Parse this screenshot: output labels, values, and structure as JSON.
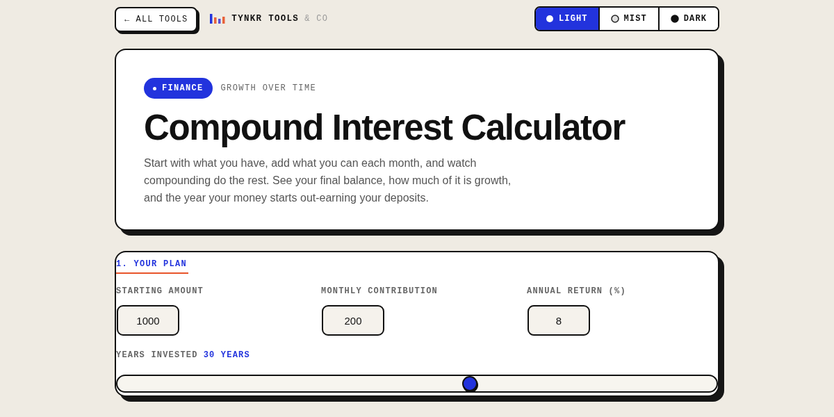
{
  "header": {
    "back_button": "← ALL TOOLS",
    "brand": {
      "name": "TYNKR TOOLS",
      "suffix": "& CO"
    },
    "theme_options": [
      {
        "label": "LIGHT",
        "kind": "light",
        "selected": true
      },
      {
        "label": "MIST",
        "kind": "mist",
        "selected": false
      },
      {
        "label": "DARK",
        "kind": "dark",
        "selected": false
      }
    ]
  },
  "hero": {
    "badge": "FINANCE",
    "eyebrow": "GROWTH OVER TIME",
    "title": "Compound Interest Calculator",
    "description": "Start with what you have, add what you can each month, and watch compounding do the rest. See your final balance, how much of it is growth, and the year your money starts out-earning your deposits."
  },
  "plan": {
    "heading": "1. YOUR PLAN",
    "fields": [
      {
        "label": "STARTING AMOUNT",
        "value": "1000"
      },
      {
        "label": "MONTHLY CONTRIBUTION",
        "value": "200"
      },
      {
        "label": "ANNUAL RETURN (%)",
        "value": "8"
      }
    ],
    "years": {
      "label": "YEARS INVESTED",
      "reading": "30 YEARS",
      "level": 0.59
    }
  }
}
